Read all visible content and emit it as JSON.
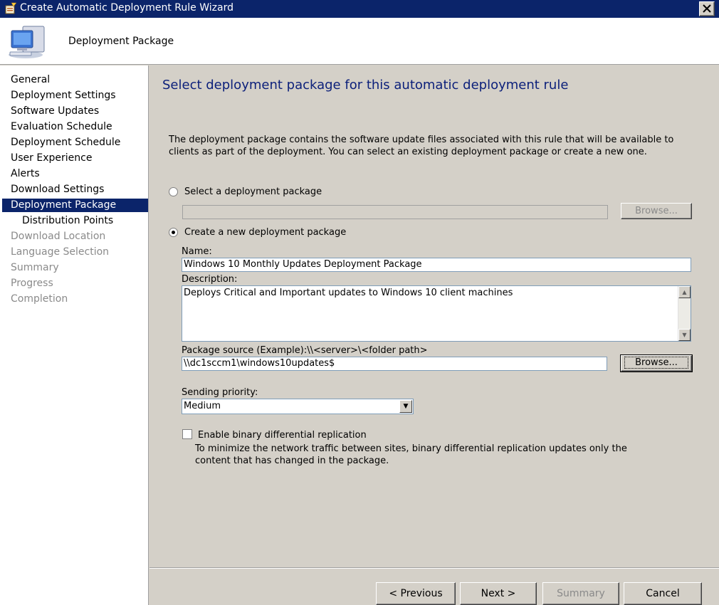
{
  "window": {
    "title": "Create Automatic Deployment Rule Wizard"
  },
  "header": {
    "title": "Deployment Package"
  },
  "sidebar": {
    "items": [
      {
        "label": "General",
        "state": "done"
      },
      {
        "label": "Deployment Settings",
        "state": "done"
      },
      {
        "label": "Software Updates",
        "state": "done"
      },
      {
        "label": "Evaluation Schedule",
        "state": "done"
      },
      {
        "label": "Deployment Schedule",
        "state": "done"
      },
      {
        "label": "User Experience",
        "state": "done"
      },
      {
        "label": "Alerts",
        "state": "done"
      },
      {
        "label": "Download Settings",
        "state": "done"
      },
      {
        "label": "Deployment Package",
        "state": "selected"
      },
      {
        "label": "Distribution Points",
        "state": "sub"
      },
      {
        "label": "Download Location",
        "state": "disabled"
      },
      {
        "label": "Language Selection",
        "state": "disabled"
      },
      {
        "label": "Summary",
        "state": "disabled"
      },
      {
        "label": "Progress",
        "state": "disabled"
      },
      {
        "label": "Completion",
        "state": "disabled"
      }
    ]
  },
  "main": {
    "heading": "Select deployment package for this automatic deployment rule",
    "description": "The deployment package contains the software update files associated with this rule that will be available to clients as part of the deployment. You can select an existing deployment package or create a new one.",
    "select_existing": {
      "label": "Select a deployment package",
      "value": "",
      "browse_label": "Browse...",
      "checked": false
    },
    "create_new": {
      "label": "Create a new deployment package",
      "checked": true,
      "name_label": "Name:",
      "name_value": "Windows 10 Monthly Updates Deployment Package",
      "description_label": "Description:",
      "description_value": "Deploys Critical and Important updates to Windows 10 client machines",
      "source_label": "Package source (Example):\\\\<server>\\<folder path>",
      "source_value": "\\\\dc1sccm1\\windows10updates$",
      "browse_label": "Browse...",
      "priority_label": "Sending priority:",
      "priority_value": "Medium",
      "binary_label": "Enable binary differential replication",
      "binary_checked": false,
      "binary_help": "To minimize the network traffic between sites, binary differential replication updates only the content that has changed in the package."
    }
  },
  "footer": {
    "previous_label": "< Previous",
    "next_label": "Next >",
    "summary_label": "Summary",
    "cancel_label": "Cancel"
  }
}
